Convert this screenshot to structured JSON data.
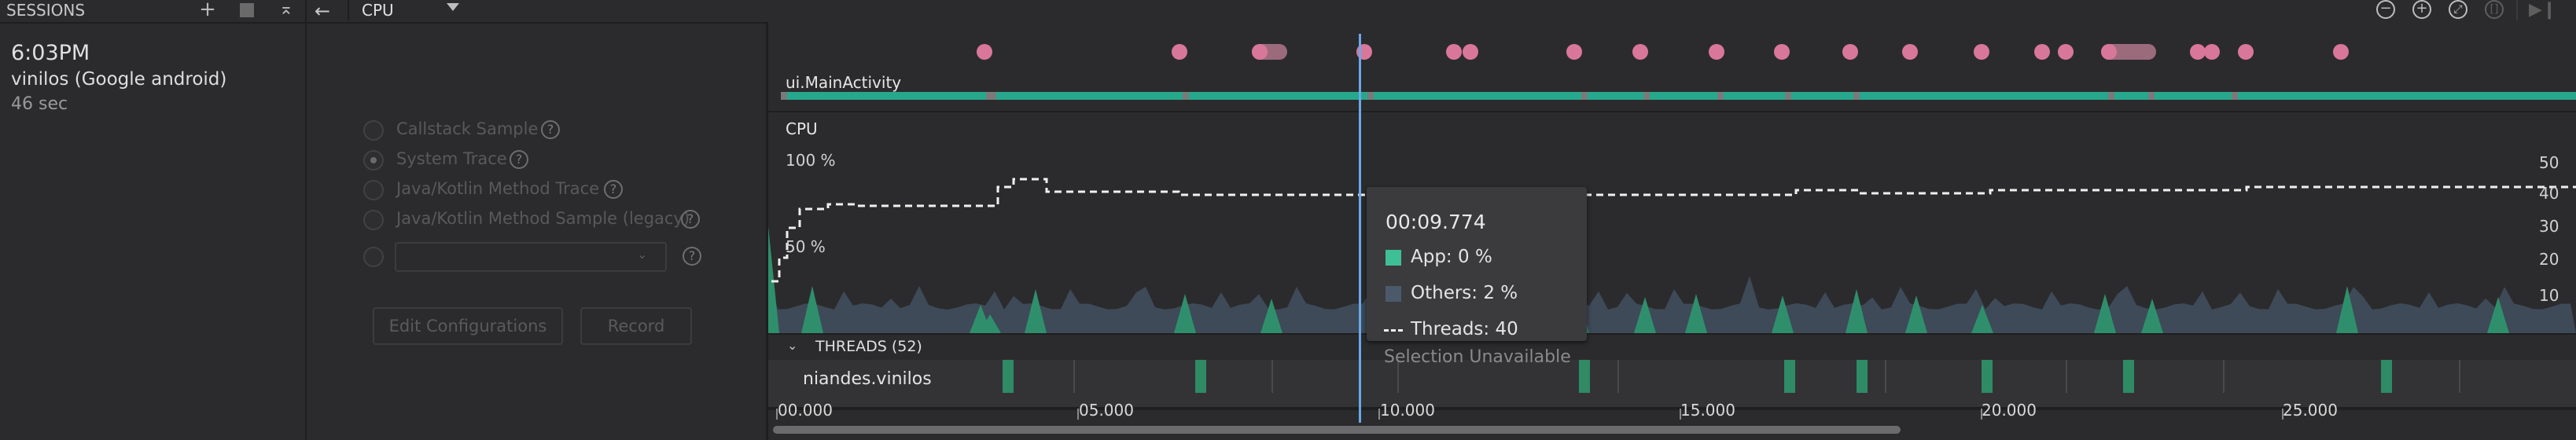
{
  "sessions": {
    "title": "SESSIONS",
    "time": "6:03PM",
    "device": "vinilos (Google android)",
    "duration": "46 sec"
  },
  "toolbar": {
    "profiler": "CPU"
  },
  "config": {
    "options": [
      {
        "label": "Callstack Sample",
        "selected": false
      },
      {
        "label": "System Trace",
        "selected": true
      },
      {
        "label": "Java/Kotlin Method Trace",
        "selected": false
      },
      {
        "label": "Java/Kotlin Method Sample (legacy)",
        "selected": false
      }
    ],
    "edit_button": "Edit Configurations",
    "record_button": "Record"
  },
  "timeline": {
    "activity_label": "ui.MainActivity",
    "cpu_label": "CPU",
    "y_left": [
      "100 %",
      "50 %"
    ],
    "y_right": [
      "50",
      "40",
      "30",
      "20",
      "10"
    ],
    "threads_header": "THREADS (52)",
    "thread_name": "niandes.vinilos",
    "ruler": [
      "00.000",
      "05.000",
      "10.000",
      "15.000",
      "20.000",
      "25.000"
    ]
  },
  "tooltip": {
    "time": "00:09.774",
    "app": "App: 0 %",
    "others": "Others: 2 %",
    "threads": "Threads: 40",
    "selection": "Selection Unavailable"
  },
  "colors": {
    "app": "#3fbf94",
    "others": "#4a5a6b",
    "event": "#d9779a",
    "cursor": "#6aa8e8"
  }
}
